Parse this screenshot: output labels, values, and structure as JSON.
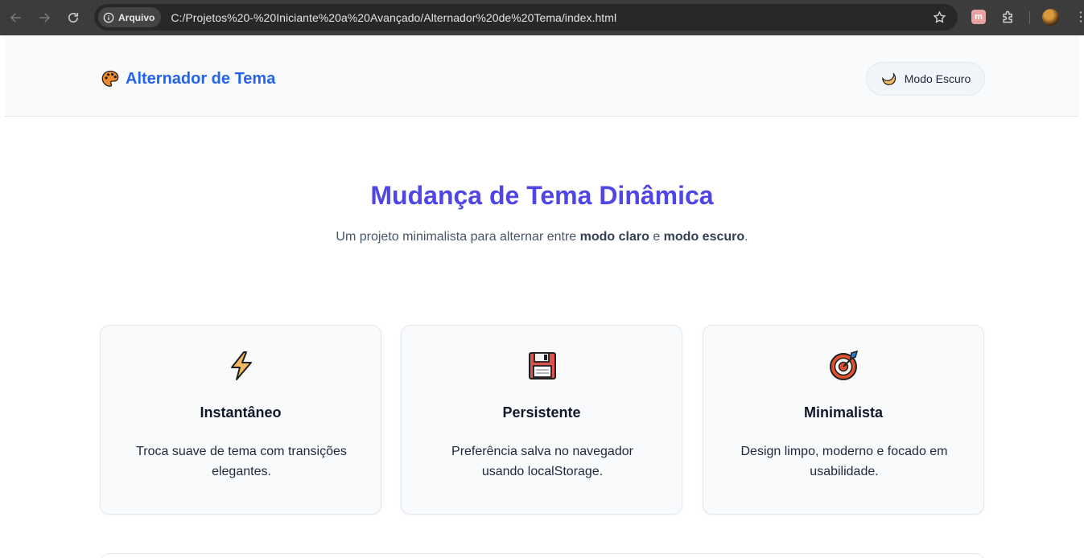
{
  "browser": {
    "security_chip": "Arquivo",
    "url": "C:/Projetos%20-%20Iniciante%20a%20Avançado/Alternador%20de%20Tema/index.html",
    "extension_label": "m"
  },
  "header": {
    "logo_icon": "palette-icon",
    "logo_text": "Alternador de Tema",
    "theme_button": {
      "icon": "moon-icon",
      "label": "Modo Escuro"
    }
  },
  "hero": {
    "title": "Mudança de Tema Dinâmica",
    "subtitle_prefix": "Um projeto minimalista para alternar entre ",
    "subtitle_bold_1": "modo claro",
    "subtitle_middle": " e ",
    "subtitle_bold_2": "modo escuro",
    "subtitle_suffix": "."
  },
  "features": [
    {
      "icon": "lightning-icon",
      "title": "Instantâneo",
      "description": "Troca suave de tema com transições elegantes."
    },
    {
      "icon": "floppy-disk-icon",
      "title": "Persistente",
      "description": "Preferência salva no navegador usando localStorage."
    },
    {
      "icon": "target-icon",
      "title": "Minimalista",
      "description": "Design limpo, moderno e focado em usabilidade."
    }
  ],
  "colors": {
    "accent_blue": "#2563eb",
    "hero_indigo": "#4f46e5",
    "surface": "#f8fafc",
    "border": "#e2e8f0"
  }
}
